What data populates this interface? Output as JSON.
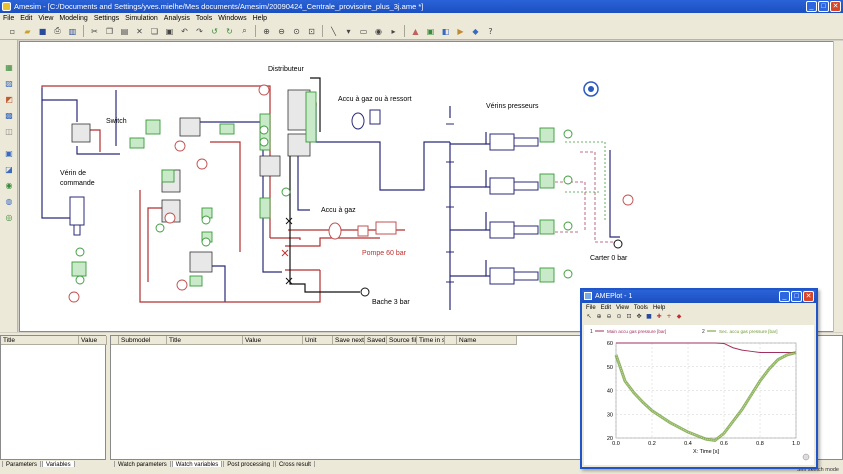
{
  "window": {
    "title": "Amesim - [C:/Documents and Settings/yves.mielhe/Mes documents/Amesim/20090424_Centrale_provisoire_plus_3j.ame *]",
    "controls": [
      "_",
      "□",
      "✕"
    ]
  },
  "menu": [
    "File",
    "Edit",
    "View",
    "Modeling",
    "Settings",
    "Simulation",
    "Analysis",
    "Tools",
    "Windows",
    "Help"
  ],
  "toolbar_icons": [
    "new-icon",
    "open-icon",
    "save-icon",
    "print-icon",
    "book-icon",
    "cut-icon",
    "copy-icon",
    "paste-icon",
    "delete-icon",
    "copy-special-icon",
    "paste-special-icon",
    "rotate-left-icon",
    "rotate-right-icon",
    "undo-icon",
    "redo-icon",
    "find-icon",
    "zoom-in-icon",
    "zoom-out-icon",
    "zoom-fit-icon",
    "zoom-window-icon",
    "line-icon",
    "text-icon",
    "component-icon",
    "disk-icon",
    "simulate-icon",
    "sketch-mode-icon",
    "submodel-mode-icon",
    "parameter-mode-icon",
    "simulation-mode-icon",
    "python-icon",
    "help-icon"
  ],
  "diagram": {
    "labels": {
      "distributeur": "Distributeur",
      "switch": "Switch",
      "accu_gaz_ressort": "Accu à gaz ou à ressort",
      "verins_presseurs": "Vérins presseurs",
      "verin_commande_1": "Vérin de",
      "verin_commande_2": "commande",
      "accu_gaz": "Accu à gaz",
      "pompe": "Pompe 60 bar",
      "carter": "Carter 0 bar",
      "bache": "Bache 3 bar"
    },
    "colors": {
      "blue": "#2a2a7a",
      "red": "#b03030",
      "green": "#3a9a3a",
      "black": "#111111"
    }
  },
  "left_panel": {
    "headers": [
      "Title",
      "Value"
    ]
  },
  "right_panel": {
    "headers": [
      "Submodel",
      "Title",
      "Value",
      "Unit",
      "Save next",
      "Saved",
      "Source file",
      "Time in s",
      "Name"
    ]
  },
  "bottom_tabs_left": [
    "Parameters",
    "Variables"
  ],
  "bottom_tabs_right": [
    "Watch parameters",
    "Watch variables",
    "Post processing",
    "Cross result"
  ],
  "status": "Sim sketch mode",
  "plot_window": {
    "title": "AMEPlot - 1",
    "menu": [
      "File",
      "Edit",
      "View",
      "Tools",
      "Help"
    ],
    "toolbar_icons": [
      "select-icon",
      "zoom-in-icon",
      "zoom-out-icon",
      "zoom-fit-icon",
      "zoom-area-icon",
      "pan-icon",
      "export-icon",
      "add-curve-icon",
      "remove-curve-icon",
      "plus-icon"
    ]
  },
  "chart_data": {
    "type": "line",
    "title": "",
    "xlabel": "X: Time [s]",
    "ylabel": "",
    "xlim": [
      0,
      1
    ],
    "ylim": [
      20,
      60
    ],
    "xticks": [
      "0.0",
      "0.2",
      "0.4",
      "0.6",
      "0.8",
      "1.0"
    ],
    "yticks": [
      "20",
      "30",
      "40",
      "50",
      "60"
    ],
    "grid": true,
    "series": [
      {
        "name": "Main accu gas pressure [bar]",
        "legend_index": "1",
        "color": "#a03060",
        "x": [
          0,
          0.5,
          0.55,
          0.6,
          0.65,
          0.7,
          0.75,
          0.8,
          0.85,
          0.9,
          1.0
        ],
        "y": [
          60,
          60,
          60,
          59.8,
          58,
          57,
          56.5,
          56,
          56,
          56,
          56
        ]
      },
      {
        "name": "Sec. accu gas pressure [bar]",
        "legend_index": "2",
        "color": "#6a9a30",
        "x": [
          0,
          0.05,
          0.1,
          0.15,
          0.2,
          0.25,
          0.3,
          0.35,
          0.4,
          0.45,
          0.5,
          0.55,
          0.6,
          0.65,
          0.7,
          0.75,
          0.8,
          0.85,
          0.9,
          0.95,
          1.0
        ],
        "y": [
          55,
          44,
          39,
          35,
          31.5,
          29,
          26.5,
          24.5,
          22.5,
          21,
          19.5,
          19,
          22,
          27,
          32,
          38,
          44,
          49,
          53,
          55,
          56
        ]
      }
    ]
  }
}
